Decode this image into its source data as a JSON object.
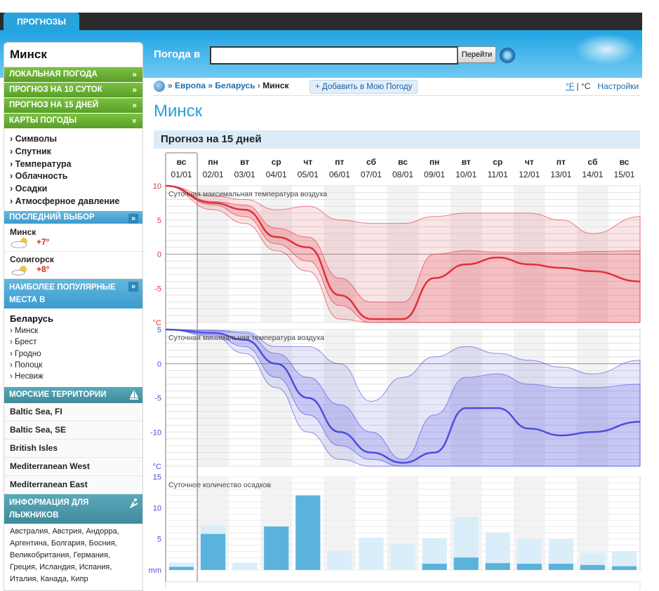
{
  "top": {
    "tab": "ПРОГНОЗЫ"
  },
  "sidebar": {
    "title": "Минск",
    "menu": [
      {
        "label": "ЛОКАЛЬНАЯ ПОГОДА",
        "arrow": "»"
      },
      {
        "label": "ПРОГНОЗ НА 10 СУТОК",
        "arrow": "»"
      },
      {
        "label": "ПРОГНОЗ НА 15 ДНЕЙ",
        "arrow": "»"
      },
      {
        "label": "КАРТЫ ПОГОДЫ",
        "arrow": "»"
      }
    ],
    "maps": [
      "› Символы",
      "› Спутник",
      "› Температура",
      "› Облачность",
      "› Осадки",
      "› Атмосферное давление"
    ],
    "recent_header": "ПОСЛЕДНИЙ ВЫБОР",
    "recent": [
      {
        "name": "Минск",
        "temp": "+7°",
        "icon": "partly-cloudy-icon"
      },
      {
        "name": "Солигорск",
        "temp": "+8°",
        "icon": "sun-cloud-icon"
      }
    ],
    "popular_header_1": "НАИБОЛЕЕ ПОПУЛЯРНЫЕ",
    "popular_header_2": "МЕСТА В",
    "country": "Беларусь",
    "cities": [
      "› Минск",
      "› Брест",
      "› Гродно",
      "› Полоцк",
      "› Несвиж"
    ],
    "sea_header": "МОРСКИЕ ТЕРРИТОРИИ",
    "seas": [
      "Baltic Sea, FI",
      "Baltic Sea, SE",
      "British Isles",
      "Mediterranean West",
      "Mediterranean East"
    ],
    "ski_header_1": "ИНФОРМАЦИЯ ДЛЯ",
    "ski_header_2": "ЛЫЖНИКОВ",
    "ski_countries": "Австралия, Австрия, Андорра, Аргентина, Болгария, Босния, Великобритания, Германия, Греция, Исландия, Испания, Италия, Канада, Кипр"
  },
  "search": {
    "label": "Погода в",
    "value": "",
    "button": "Перейти"
  },
  "breadcrumb": {
    "europe": "Европа",
    "belarus": "Беларусь",
    "current": "Минск",
    "sep": "»",
    "sep2": "›",
    "add": "+ Добавить в Мою Погоду"
  },
  "units": {
    "f": "°F",
    "sep": "|",
    "c": "°C",
    "settings": "Настройки"
  },
  "page_title": "Минск",
  "forecast_title": "Прогноз на 15 дней",
  "colors": {
    "max": "#e0303a",
    "min": "#4a4de0",
    "precip": "#5ab3dc",
    "precip_light": "#d9eef9"
  },
  "chart_data": [
    {
      "type": "line",
      "title": "Суточная максимальная температура воздуха",
      "days": [
        "вс",
        "пн",
        "вт",
        "ср",
        "чт",
        "пт",
        "сб",
        "вс",
        "пн",
        "вт",
        "ср",
        "чт",
        "пт",
        "сб",
        "вс"
      ],
      "dates": [
        "01/01",
        "02/01",
        "03/01",
        "04/01",
        "05/01",
        "06/01",
        "07/01",
        "08/01",
        "09/01",
        "10/01",
        "11/01",
        "12/01",
        "13/01",
        "14/01",
        "15/01"
      ],
      "ylabel": "°C",
      "yticks": [
        10,
        5,
        0,
        -5
      ],
      "ylim": [
        -10,
        10
      ],
      "median": [
        10,
        7.5,
        6.5,
        2.5,
        1,
        -6,
        -9.5,
        -9.5,
        -3.5,
        -1.5,
        -0.5,
        -1.5,
        -2,
        -2.5,
        -4
      ],
      "band_inner_hi": [
        10,
        7.7,
        7.2,
        3.8,
        2.5,
        -3.5,
        -7,
        -7,
        0,
        0.5,
        0.3,
        0.2,
        0.2,
        0.4,
        0.5
      ],
      "band_inner_lo": [
        10,
        7.2,
        5.5,
        1.5,
        -1,
        -7.5,
        -10,
        -10,
        -10,
        -10,
        -10,
        -10,
        -10,
        -10,
        -10
      ],
      "band_outer_hi": [
        10,
        8.5,
        8,
        6.5,
        7,
        5,
        4.5,
        4.5,
        5.5,
        6,
        6,
        6,
        5,
        3,
        5.5
      ],
      "band_outer_lo": [
        10,
        6.5,
        4.5,
        0.5,
        -2.5,
        -9.5,
        -10,
        -10,
        -10,
        -10,
        -10,
        -10,
        -10,
        -10,
        -10
      ]
    },
    {
      "type": "line",
      "title": "Суточная минимальная температура воздуха",
      "ylabel": "°C",
      "yticks": [
        5,
        0,
        -5,
        -10
      ],
      "ylim": [
        -15,
        5
      ],
      "median": [
        5,
        4.5,
        3.5,
        0,
        -5,
        -10,
        -13,
        -14.5,
        -13,
        -6.5,
        -6.5,
        -9.5,
        -10.5,
        -10,
        -8.5
      ],
      "band_inner_hi": [
        5,
        4.8,
        4.5,
        1.5,
        -2,
        -6,
        -10,
        -14,
        -7.5,
        -2,
        -1.5,
        -3,
        -3.5,
        -3.5,
        -3
      ],
      "band_inner_lo": [
        5,
        4.2,
        2.5,
        -2,
        -7.5,
        -12,
        -14,
        -15,
        -15,
        -15,
        -15,
        -15,
        -15,
        -15,
        -15
      ],
      "band_outer_hi": [
        5,
        4.9,
        4.7,
        2.5,
        2.5,
        0,
        -5.5,
        -2,
        1,
        2.5,
        1.5,
        0.5,
        -0.5,
        -1.5,
        0.5
      ],
      "band_outer_lo": [
        5,
        4,
        1.5,
        -3.5,
        -10,
        -14,
        -15,
        -15,
        -15,
        -15,
        -15,
        -15,
        -15,
        -15,
        -15
      ]
    },
    {
      "type": "bar",
      "title": "Суточное количество осадков",
      "ylabel": "mm",
      "yticks": [
        15,
        10,
        5
      ],
      "ylim": [
        0,
        15
      ],
      "dark": [
        0.5,
        5.8,
        0,
        7,
        12,
        0,
        0,
        0,
        1,
        2,
        1.1,
        1,
        1,
        0.8,
        0.6
      ],
      "light": [
        1.2,
        7.2,
        1.2,
        7,
        12,
        3,
        5.2,
        4.2,
        5.1,
        8.5,
        6,
        5,
        5,
        2.8,
        3
      ]
    }
  ]
}
